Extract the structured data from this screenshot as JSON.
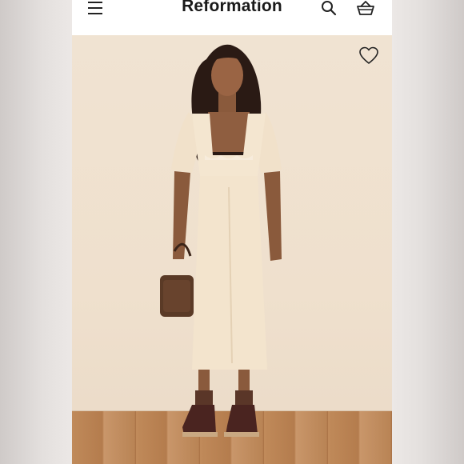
{
  "app": {
    "brand": "Reformation"
  },
  "header": {
    "icons": [
      "menu-icon",
      "search-icon",
      "bag-icon"
    ]
  },
  "product": {
    "image": "model-in-cream-midi-dress",
    "favorite_icon": "heart-icon"
  },
  "colors": {
    "background": "#f0e3d2",
    "dress": "#f3e5cf",
    "text": "#1a1a1a"
  }
}
